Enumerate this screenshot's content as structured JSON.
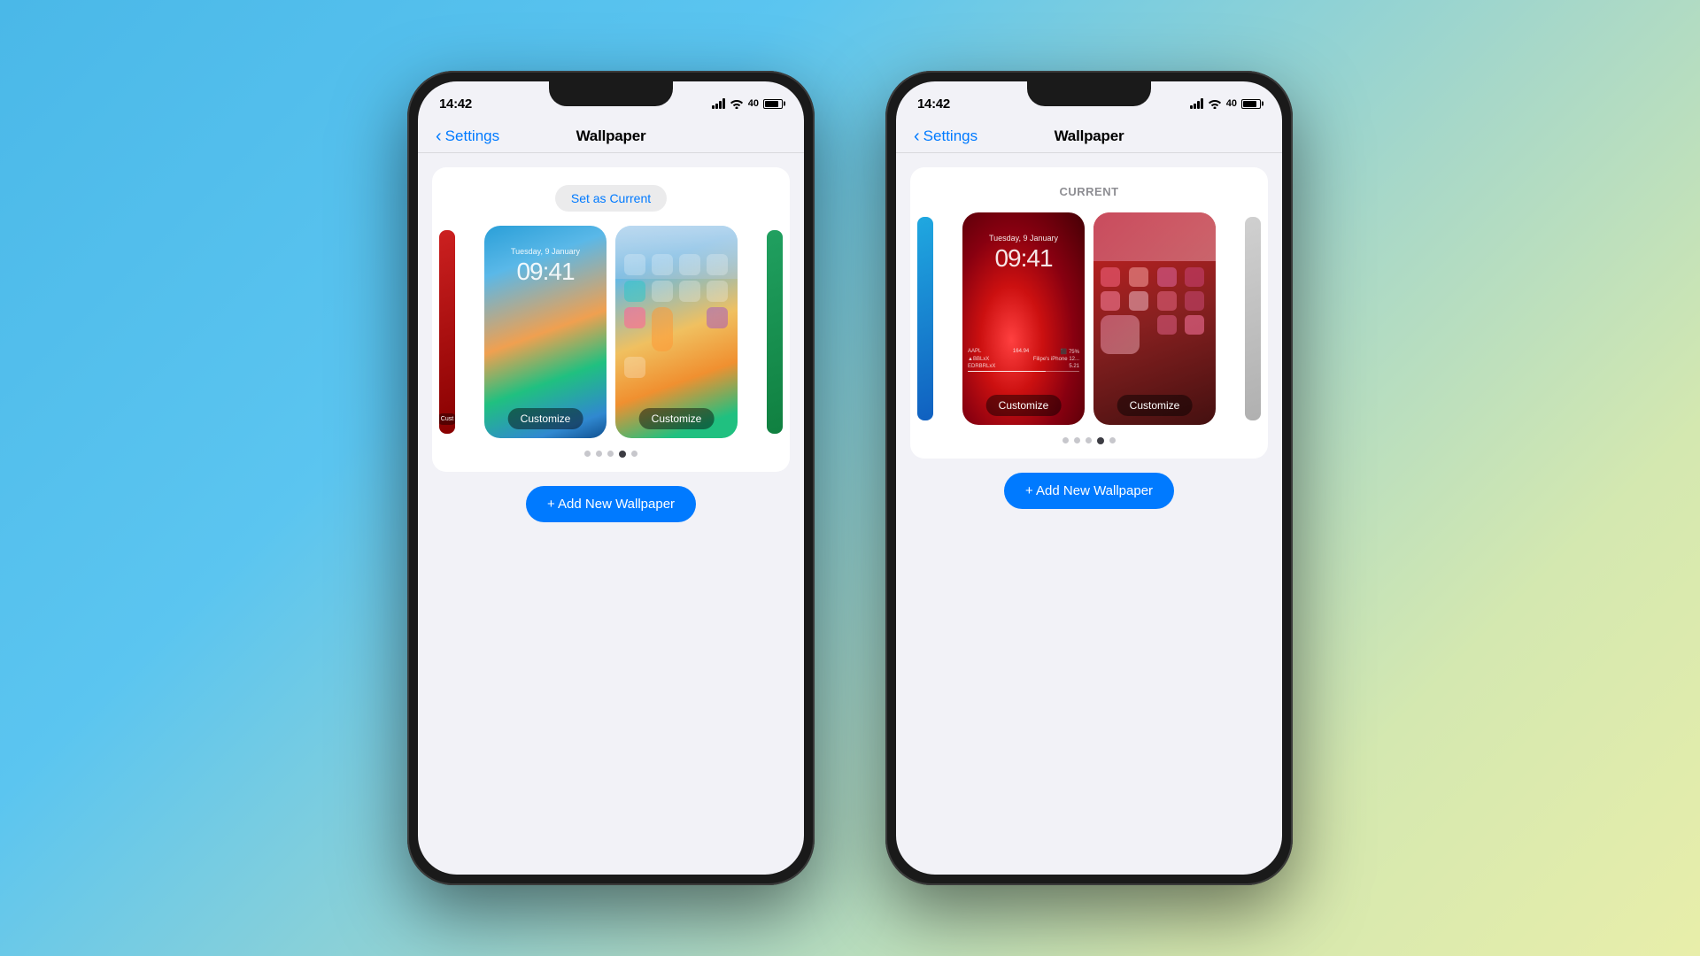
{
  "background": {
    "gradient_start": "#4ab8e8",
    "gradient_end": "#e8eeaa"
  },
  "phone_left": {
    "status_bar": {
      "time": "14:42",
      "battery_percent": "40"
    },
    "nav": {
      "back_label": "Settings",
      "title": "Wallpaper"
    },
    "wallpaper_section": {
      "badge_label": "Set as Current",
      "previews": [
        {
          "type": "lock_screen",
          "style": "blue_gradient",
          "date": "Tuesday, 9 January",
          "time": "09:41",
          "customize_label": "Customize"
        },
        {
          "type": "home_screen",
          "style": "blue_gradient",
          "customize_label": "Customize"
        }
      ],
      "pagination": {
        "total": 5,
        "active": 3
      },
      "add_button_label": "+ Add New Wallpaper"
    }
  },
  "phone_right": {
    "status_bar": {
      "time": "14:42",
      "battery_percent": "40"
    },
    "nav": {
      "back_label": "Settings",
      "title": "Wallpaper"
    },
    "wallpaper_section": {
      "current_label": "CURRENT",
      "previews": [
        {
          "type": "lock_screen",
          "style": "red_gradient",
          "date": "Tuesday, 9 January",
          "time": "09:41",
          "customize_label": "Customize"
        },
        {
          "type": "home_screen",
          "style": "red_dark",
          "customize_label": "Customize"
        }
      ],
      "pagination": {
        "total": 5,
        "active": 4
      },
      "add_button_label": "+ Add New Wallpaper"
    }
  }
}
